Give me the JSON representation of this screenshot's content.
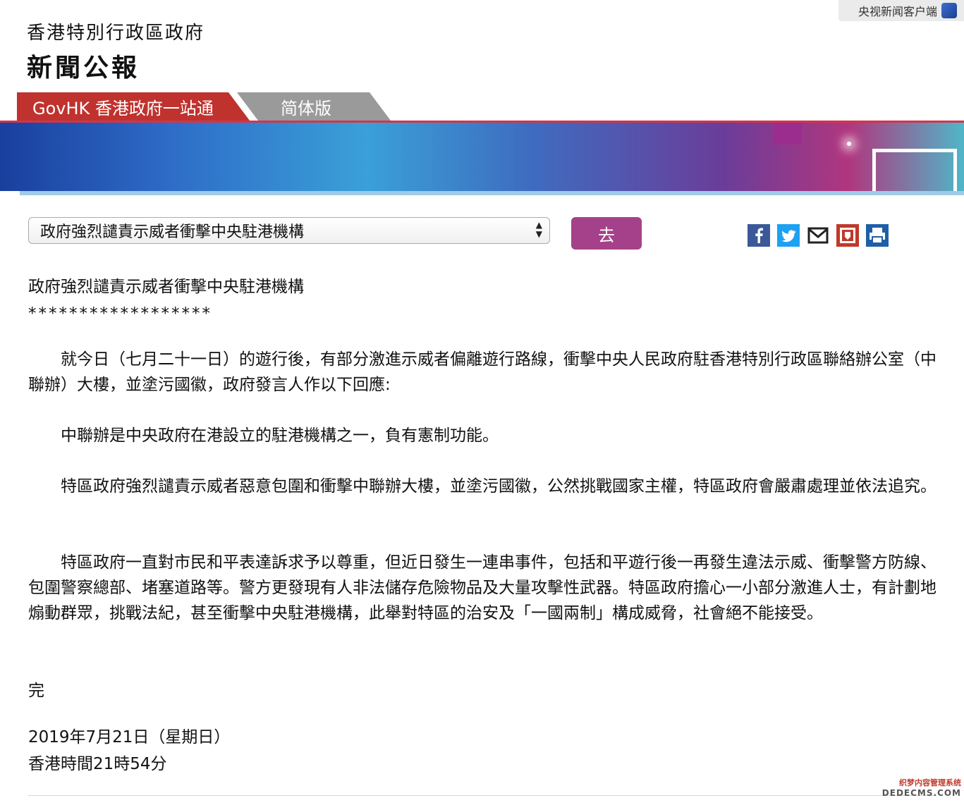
{
  "watermark_top": {
    "text": "央视新闻客户端",
    "logo_text": "央视新闻"
  },
  "header": {
    "title": "香港特別行政區政府",
    "subtitle": "新聞公報"
  },
  "tabs": {
    "govhk": "GovHK 香港政府一站通",
    "simplified": "简体版"
  },
  "toolbar": {
    "select_value": "政府強烈譴責示威者衝擊中央駐港機構",
    "go_label": "去",
    "share_icons": [
      "facebook-icon",
      "twitter-icon",
      "email-icon",
      "bookmark-icon",
      "print-icon"
    ]
  },
  "article": {
    "headline": "政府強烈譴責示威者衝擊中央駐港機構",
    "stars": "******************",
    "paragraphs": [
      "就今日（七月二十一日）的遊行後，有部分激進示威者偏離遊行路線，衝擊中央人民政府駐香港特別行政區聯絡辦公室（中聯辦）大樓，並塗污國徽，政府發言人作以下回應:",
      "中聯辦是中央政府在港設立的駐港機構之一，負有憲制功能。",
      "特區政府強烈譴責示威者惡意包圍和衝擊中聯辦大樓，並塗污國徽，公然挑戰國家主權，特區政府會嚴肅處理並依法追究。",
      "特區政府一直對市民和平表達訴求予以尊重，但近日發生一連串事件，包括和平遊行後一再發生違法示威、衝擊警方防線、包圍警察總部、堵塞道路等。警方更發現有人非法儲存危險物品及大量攻擊性武器。特區政府擔心一小部分激進人士，有計劃地煽動群眾，挑戰法紀，甚至衝擊中央駐港機構，此舉對特區的治安及「一國兩制」構成威脅，社會絕不能接受。"
    ],
    "end_mark": "完",
    "date": "2019年7月21日（星期日）",
    "time": "香港時間21時54分"
  },
  "watermark_bottom": {
    "line1": "织梦内容管理系统",
    "line2": "DEDECMS.COM"
  },
  "colors": {
    "tab_red": "#c0322e",
    "tab_gray": "#9a9a9a",
    "go_button": "#a5418a",
    "facebook": "#3b5998",
    "twitter": "#1da1f2"
  }
}
